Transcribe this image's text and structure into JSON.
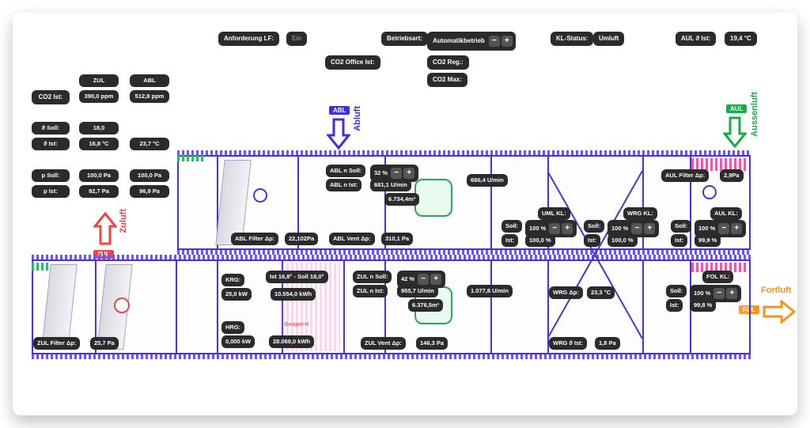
{
  "header": {
    "anforderung_lf_label": "Anforderung LF:",
    "anforderung_lf_value": "Ein",
    "betriebsart_label": "Betriebsart:",
    "betriebsart_value": "Automatikbetrieb",
    "kl_status_label": "KL-Status:",
    "kl_status_value": "Umluft",
    "aul_theta_label": "AUL ϑ Ist:",
    "aul_theta_value": "19,4 °C",
    "co2_office_ist_label": "CO2 Office Ist:",
    "co2_reg_label": "CO2 Reg.:",
    "co2_max_label": "CO2 Max:"
  },
  "left_panel": {
    "co2_ist_label": "CO2 Ist:",
    "zul_label": "ZUL",
    "zul_value": "390,0 ppm",
    "abl_label": "ABL",
    "abl_value": "512,8 ppm",
    "theta_soll_label": "ϑ Soll:",
    "theta_soll_value": "18,0",
    "theta_ist_label": "ϑ Ist:",
    "theta_ist_value": "16,8 °C",
    "theta_abl_value": "23,7 °C",
    "p_soll_label": "p Soll:",
    "p_soll_value": "100,0 Pa",
    "p_ist_label": "p Ist:",
    "p_ist_value": "92,7 Pa",
    "p_abl_soll": "100,0 Pa",
    "p_abl_ist": "96,9 Pa"
  },
  "ducts": {
    "abluft_label": "Abluft",
    "zuluft_label": "Zuluft",
    "aussenluft_label": "Aussenluft",
    "fortluft_label": "Fortluft",
    "abl_badge": "ABL",
    "zul_badge": "ZUL",
    "aul_badge": "AUL",
    "fol_badge": "FOL"
  },
  "top_row": {
    "abl_filter_dp_label": "ABL Filter Δp:",
    "abl_filter_dp_value": "22,102Pa",
    "abl_n_soll_label": "ABL n Soll:",
    "abl_n_soll_pct": "32 %",
    "abl_n_ist_label": "ABL n Ist:",
    "abl_n_ist_value": "681,1 U/min",
    "abl_cap_value": "6.734,4m³",
    "abl_vent_dp_label": "ABL Vent Δp:",
    "abl_vent_dp_value": "310,1 Pa",
    "abl_opp_value": "686,4 U/min",
    "uml_kl_label": "UML KL:",
    "wrg_kl_label": "WRG KL:",
    "aul_kl_label": "AUL KL:",
    "soll_label": "Soll:",
    "ist_label": "Ist:",
    "uml_soll": "100 %",
    "uml_ist": "100,0 %",
    "wrg_soll": "100 %",
    "wrg_ist": "100,0 %",
    "aul_soll": "100 %",
    "aul_ist": "99,9 %",
    "aul_filter_dp_label": "AUL Filter Δp:",
    "aul_filter_dp_value": "2,9Pa"
  },
  "bottom_row": {
    "zul_filter_dp_label": "ZUL Filter Δp:",
    "zul_filter_dp_value": "25,7 Pa",
    "krg_label": "KRG:",
    "krg_value": "25,0 kW",
    "hrg_label": "HRG:",
    "hrg_value": "0,000 kW",
    "ist_soll_line": "Ist 16,8° - Soll 18,0°",
    "kwh1": "10.554,0 kWh",
    "kwh2": "28.069,0 kWh",
    "gesperrt": "Gesperrt",
    "zul_n_soll_label": "ZUL n Soll:",
    "zul_n_soll_pct": "42 %",
    "zul_n_ist_label": "ZUL n Ist:",
    "zul_n_ist_value": "955,7 U/min",
    "zul_cap_value": "6.376,5m³",
    "zul_opp_value": "1.077,8 U/min",
    "zul_vent_dp_label": "ZUL Vent Δp:",
    "zul_vent_dp_value": "146,3 Pa",
    "wrg_dp_label": "WRG Δp:",
    "wrg_dp_value": "23,3 °C",
    "wrg_theta_label": "WRG ϑ Ist:",
    "wrg_theta_value": "1,8 Pa",
    "fol_kl_label": "FOL KL:",
    "fol_soll": "100 %",
    "fol_ist": "99,8 %"
  },
  "colors": {
    "red": "#e44",
    "blue": "#3b2fe0",
    "green": "#1aab4a",
    "orange": "#f7941e",
    "pink": "#e85aa8"
  }
}
